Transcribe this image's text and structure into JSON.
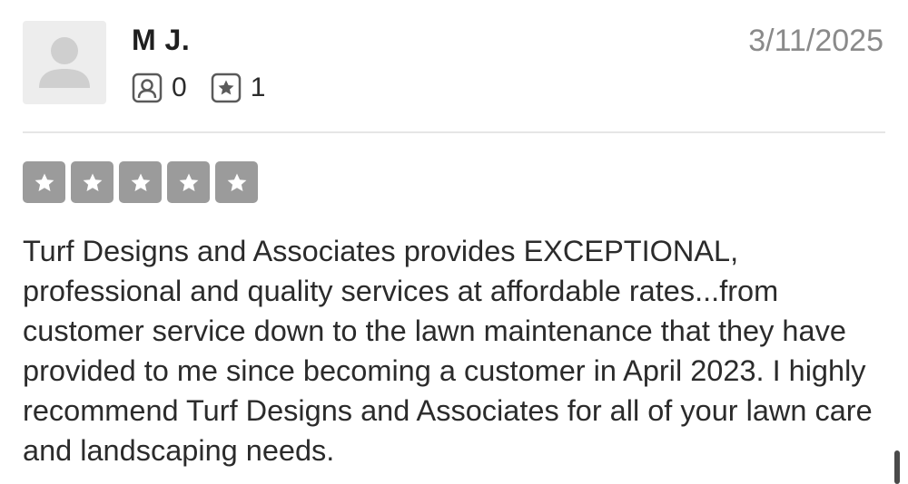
{
  "review": {
    "user": {
      "name": "M J.",
      "friends_count": "0",
      "reviews_count": "1",
      "avatar_icon": "default-user-icon"
    },
    "date": "3/11/2025",
    "rating": 5,
    "rating_max": 5,
    "text": "Turf Designs and Associates provides EXCEPTIONAL, professional and quality services at affordable rates...from customer service down to the lawn maintenance that they have provided to me since becoming a customer in April 2023. I highly recommend Turf Designs and Associates for all of your lawn care and landscaping needs."
  },
  "icons": {
    "friends": "friends-icon",
    "reviews": "review-star-icon",
    "rating_star": "star-icon"
  },
  "colors": {
    "star_box": "#9b9b9b",
    "date_text": "#8a8a8a",
    "avatar_bg": "#ededed",
    "avatar_figure": "#cfcfcf",
    "divider": "#e6e6e6"
  }
}
